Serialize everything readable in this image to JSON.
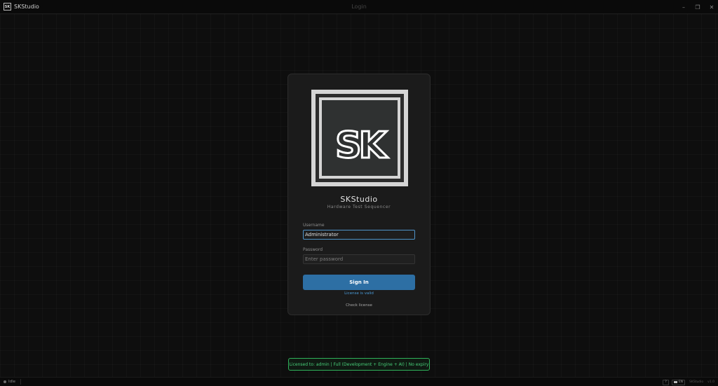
{
  "window": {
    "app_name": "SKStudio",
    "app_icon_text": "SK",
    "title": "Login",
    "controls": {
      "minimize": "–",
      "restore": "❐",
      "close": "✕"
    }
  },
  "login": {
    "logo_text": "SK",
    "brand_title": "SKStudio",
    "brand_subtitle": "Hardware Test Sequencer",
    "username_label": "Username",
    "username_value": "Administrator",
    "password_label": "Password",
    "password_placeholder": "Enter password",
    "signin_label": "Sign In",
    "license_status": "License is valid",
    "check_license_label": "Check license"
  },
  "license_banner": {
    "text": "Licensed to: admin | Full (Development + Engine + AI) | No expiry"
  },
  "statusbar": {
    "status": "Idle",
    "help_label": "?",
    "language": "EN",
    "app_name": "SKStudio",
    "version": "v1.0"
  },
  "colors": {
    "accent": "#2d6fa4",
    "link": "#4a9ad6",
    "license_ok": "#48d07a",
    "focus_border": "#4f94c9"
  }
}
